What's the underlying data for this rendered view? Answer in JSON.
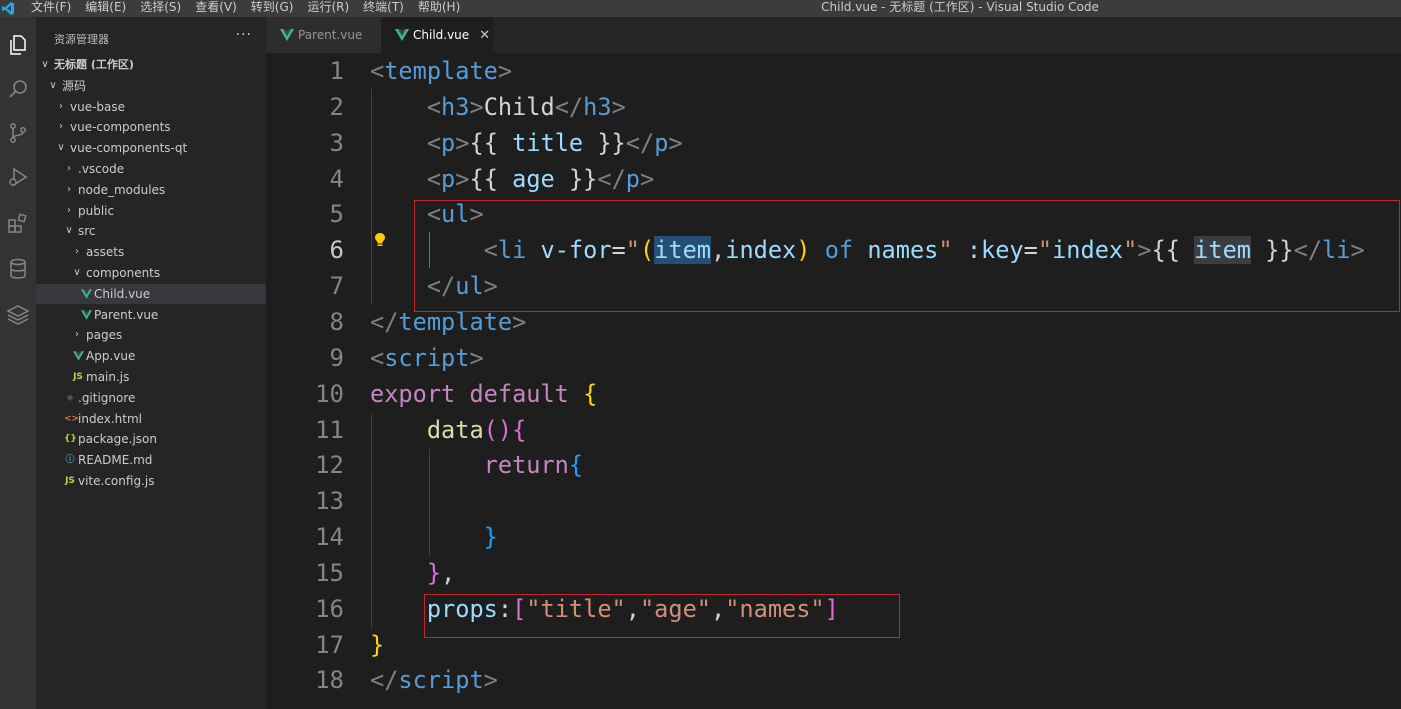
{
  "window": {
    "title": "Child.vue - 无标题 (工作区) - Visual Studio Code",
    "menu": [
      "文件(F)",
      "编辑(E)",
      "选择(S)",
      "查看(V)",
      "转到(G)",
      "运行(R)",
      "终端(T)",
      "帮助(H)"
    ]
  },
  "sidebar": {
    "title": "资源管理器",
    "more": "···",
    "tree": [
      {
        "label": "无标题 (工作区)",
        "chevron": "open",
        "depth": 0,
        "bold": true
      },
      {
        "label": "源码",
        "chevron": "open",
        "depth": 1
      },
      {
        "label": "vue-base",
        "chevron": "closed",
        "depth": 2
      },
      {
        "label": "vue-components",
        "chevron": "closed",
        "depth": 2
      },
      {
        "label": "vue-components-qt",
        "chevron": "open",
        "depth": 2
      },
      {
        "label": ".vscode",
        "chevron": "closed",
        "depth": 3
      },
      {
        "label": "node_modules",
        "chevron": "closed",
        "depth": 3
      },
      {
        "label": "public",
        "chevron": "closed",
        "depth": 3
      },
      {
        "label": "src",
        "chevron": "open",
        "depth": 3
      },
      {
        "label": "assets",
        "chevron": "closed",
        "depth": 4
      },
      {
        "label": "components",
        "chevron": "open",
        "depth": 4
      },
      {
        "label": "Child.vue",
        "icon": "vue-icon",
        "depth": 5,
        "selected": true
      },
      {
        "label": "Parent.vue",
        "icon": "vue-icon",
        "depth": 5
      },
      {
        "label": "pages",
        "chevron": "closed",
        "depth": 4
      },
      {
        "label": "App.vue",
        "icon": "vue-icon",
        "depth": 4
      },
      {
        "label": "main.js",
        "icon": "js-icon",
        "icon_text": "JS",
        "depth": 4
      },
      {
        "label": ".gitignore",
        "icon": "git-icon",
        "icon_text": "◆",
        "depth": 3
      },
      {
        "label": "index.html",
        "icon": "html-icon",
        "icon_text": "<>",
        "depth": 3
      },
      {
        "label": "package.json",
        "icon": "json-icon",
        "icon_text": "{}",
        "depth": 3
      },
      {
        "label": "README.md",
        "icon": "info-icon",
        "icon_text": "ⓘ",
        "depth": 3
      },
      {
        "label": "vite.config.js",
        "icon": "js-icon",
        "icon_text": "JS",
        "depth": 3
      }
    ]
  },
  "tabs": [
    {
      "label": "Parent.vue",
      "active": false
    },
    {
      "label": "Child.vue",
      "active": true,
      "close": "✕"
    }
  ],
  "editor": {
    "current_line": 6,
    "lines": [
      {
        "n": "1",
        "tokens": [
          [
            "t-punc",
            "<"
          ],
          [
            "t-tag",
            "template"
          ],
          [
            "t-punc",
            ">"
          ]
        ]
      },
      {
        "n": "2",
        "tokens": [
          [
            "t-plain",
            "    "
          ],
          [
            "t-punc",
            "<"
          ],
          [
            "t-tag",
            "h3"
          ],
          [
            "t-punc",
            ">"
          ],
          [
            "t-plain",
            "Child"
          ],
          [
            "t-punc",
            "</"
          ],
          [
            "t-tag",
            "h3"
          ],
          [
            "t-punc",
            ">"
          ]
        ]
      },
      {
        "n": "3",
        "tokens": [
          [
            "t-plain",
            "    "
          ],
          [
            "t-punc",
            "<"
          ],
          [
            "t-tag",
            "p"
          ],
          [
            "t-punc",
            ">"
          ],
          [
            "t-plain",
            "{{ "
          ],
          [
            "t-var",
            "title"
          ],
          [
            "t-plain",
            " }}"
          ],
          [
            "t-punc",
            "</"
          ],
          [
            "t-tag",
            "p"
          ],
          [
            "t-punc",
            ">"
          ]
        ]
      },
      {
        "n": "4",
        "tokens": [
          [
            "t-plain",
            "    "
          ],
          [
            "t-punc",
            "<"
          ],
          [
            "t-tag",
            "p"
          ],
          [
            "t-punc",
            ">"
          ],
          [
            "t-plain",
            "{{ "
          ],
          [
            "t-var",
            "age"
          ],
          [
            "t-plain",
            " }}"
          ],
          [
            "t-punc",
            "</"
          ],
          [
            "t-tag",
            "p"
          ],
          [
            "t-punc",
            ">"
          ]
        ]
      },
      {
        "n": "5",
        "tokens": [
          [
            "t-plain",
            "    "
          ],
          [
            "t-punc",
            "<"
          ],
          [
            "t-tag",
            "ul"
          ],
          [
            "t-punc",
            ">"
          ]
        ]
      },
      {
        "n": "6",
        "tokens": [
          [
            "t-plain",
            "        "
          ],
          [
            "t-punc",
            "<"
          ],
          [
            "t-tag",
            "li"
          ],
          [
            "t-plain",
            " "
          ],
          [
            "t-attr",
            "v-for"
          ],
          [
            "t-plain",
            "="
          ],
          [
            "t-str",
            "\""
          ],
          [
            "t-b1",
            "("
          ],
          [
            "t-var hl1",
            "item"
          ],
          [
            "t-plain",
            ","
          ],
          [
            "t-var",
            "index"
          ],
          [
            "t-b1",
            ")"
          ],
          [
            "t-plain",
            " "
          ],
          [
            "t-tag",
            "of"
          ],
          [
            "t-plain",
            " "
          ],
          [
            "t-var",
            "names"
          ],
          [
            "t-str",
            "\""
          ],
          [
            "t-plain",
            " "
          ],
          [
            "t-attr",
            ":key"
          ],
          [
            "t-plain",
            "="
          ],
          [
            "t-str",
            "\""
          ],
          [
            "t-var",
            "index"
          ],
          [
            "t-str",
            "\""
          ],
          [
            "t-punc",
            ">"
          ],
          [
            "t-plain",
            "{{ "
          ],
          [
            "t-var hl2",
            "item"
          ],
          [
            "t-plain",
            " }}"
          ],
          [
            "t-punc",
            "</"
          ],
          [
            "t-tag",
            "li"
          ],
          [
            "t-punc",
            ">"
          ]
        ]
      },
      {
        "n": "7",
        "tokens": [
          [
            "t-plain",
            "    "
          ],
          [
            "t-punc",
            "</"
          ],
          [
            "t-tag",
            "ul"
          ],
          [
            "t-punc",
            ">"
          ]
        ]
      },
      {
        "n": "8",
        "tokens": [
          [
            "t-punc",
            "</"
          ],
          [
            "t-tag",
            "template"
          ],
          [
            "t-punc",
            ">"
          ]
        ]
      },
      {
        "n": "9",
        "tokens": [
          [
            "t-punc",
            "<"
          ],
          [
            "t-tag",
            "script"
          ],
          [
            "t-punc",
            ">"
          ]
        ]
      },
      {
        "n": "10",
        "tokens": [
          [
            "t-kw",
            "export"
          ],
          [
            "t-plain",
            " "
          ],
          [
            "t-kw",
            "default"
          ],
          [
            "t-plain",
            " "
          ],
          [
            "t-b1",
            "{"
          ]
        ]
      },
      {
        "n": "11",
        "tokens": [
          [
            "t-plain",
            "    "
          ],
          [
            "t-fn",
            "data"
          ],
          [
            "t-b2",
            "()"
          ],
          [
            "t-b2",
            "{"
          ]
        ]
      },
      {
        "n": "12",
        "tokens": [
          [
            "t-plain",
            "        "
          ],
          [
            "t-kw",
            "return"
          ],
          [
            "t-b3",
            "{"
          ]
        ]
      },
      {
        "n": "13",
        "tokens": []
      },
      {
        "n": "14",
        "tokens": [
          [
            "t-plain",
            "        "
          ],
          [
            "t-b3",
            "}"
          ]
        ]
      },
      {
        "n": "15",
        "tokens": [
          [
            "t-plain",
            "    "
          ],
          [
            "t-b2",
            "}"
          ],
          [
            "t-plain",
            ","
          ]
        ]
      },
      {
        "n": "16",
        "tokens": [
          [
            "t-plain",
            "    "
          ],
          [
            "t-var",
            "props"
          ],
          [
            "t-plain",
            ":"
          ],
          [
            "t-b2",
            "["
          ],
          [
            "t-str",
            "\"title\""
          ],
          [
            "t-plain",
            ","
          ],
          [
            "t-str",
            "\"age\""
          ],
          [
            "t-plain",
            ","
          ],
          [
            "t-str",
            "\"names\""
          ],
          [
            "t-b2",
            "]"
          ]
        ]
      },
      {
        "n": "17",
        "tokens": [
          [
            "t-b1",
            "}"
          ]
        ]
      },
      {
        "n": "18",
        "tokens": [
          [
            "t-punc",
            "</"
          ],
          [
            "t-tag",
            "script"
          ],
          [
            "t-punc",
            ">"
          ]
        ]
      }
    ]
  },
  "colors": {
    "accent_vue": "#41b883",
    "highlight_box": "#c4242b",
    "lightbulb": "#ffcc00"
  }
}
